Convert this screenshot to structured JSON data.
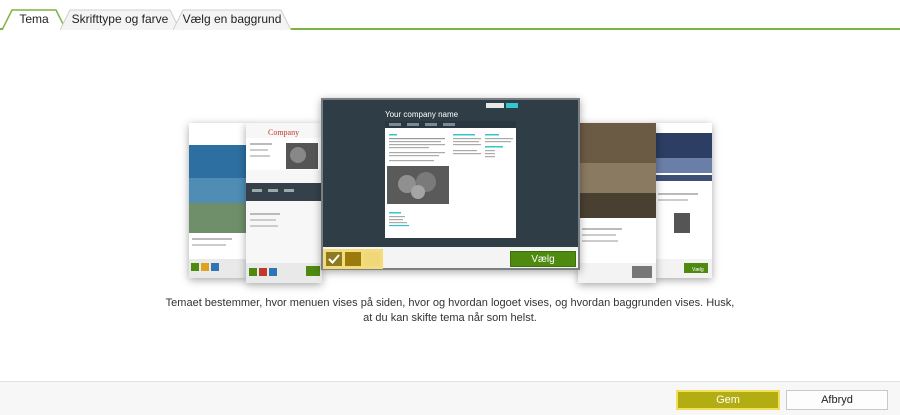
{
  "tabs": [
    {
      "label": "Tema",
      "active": true
    },
    {
      "label": "Skrifttype og farve",
      "active": false
    },
    {
      "label": "Vælg en baggrund",
      "active": false
    }
  ],
  "carousel": {
    "center": {
      "company_name": "Your company name",
      "choose_label": "Vælg"
    },
    "left_company_logo": "Company",
    "right_choose_label": "Vælg"
  },
  "description": "Temaet bestemmer, hvor menuen vises på siden, hvor og hvordan logoet vises, og hvordan baggrunden vises. Husk, at du kan skifte tema når som helst.",
  "buttons": {
    "save": "Gem",
    "cancel": "Afbryd"
  },
  "colors": {
    "accent_green": "#7cb342",
    "choose_button": "#4f8a10",
    "save_button": "#b1ad13",
    "save_border": "#f3df5a",
    "highlight": "#f5dc7a"
  }
}
